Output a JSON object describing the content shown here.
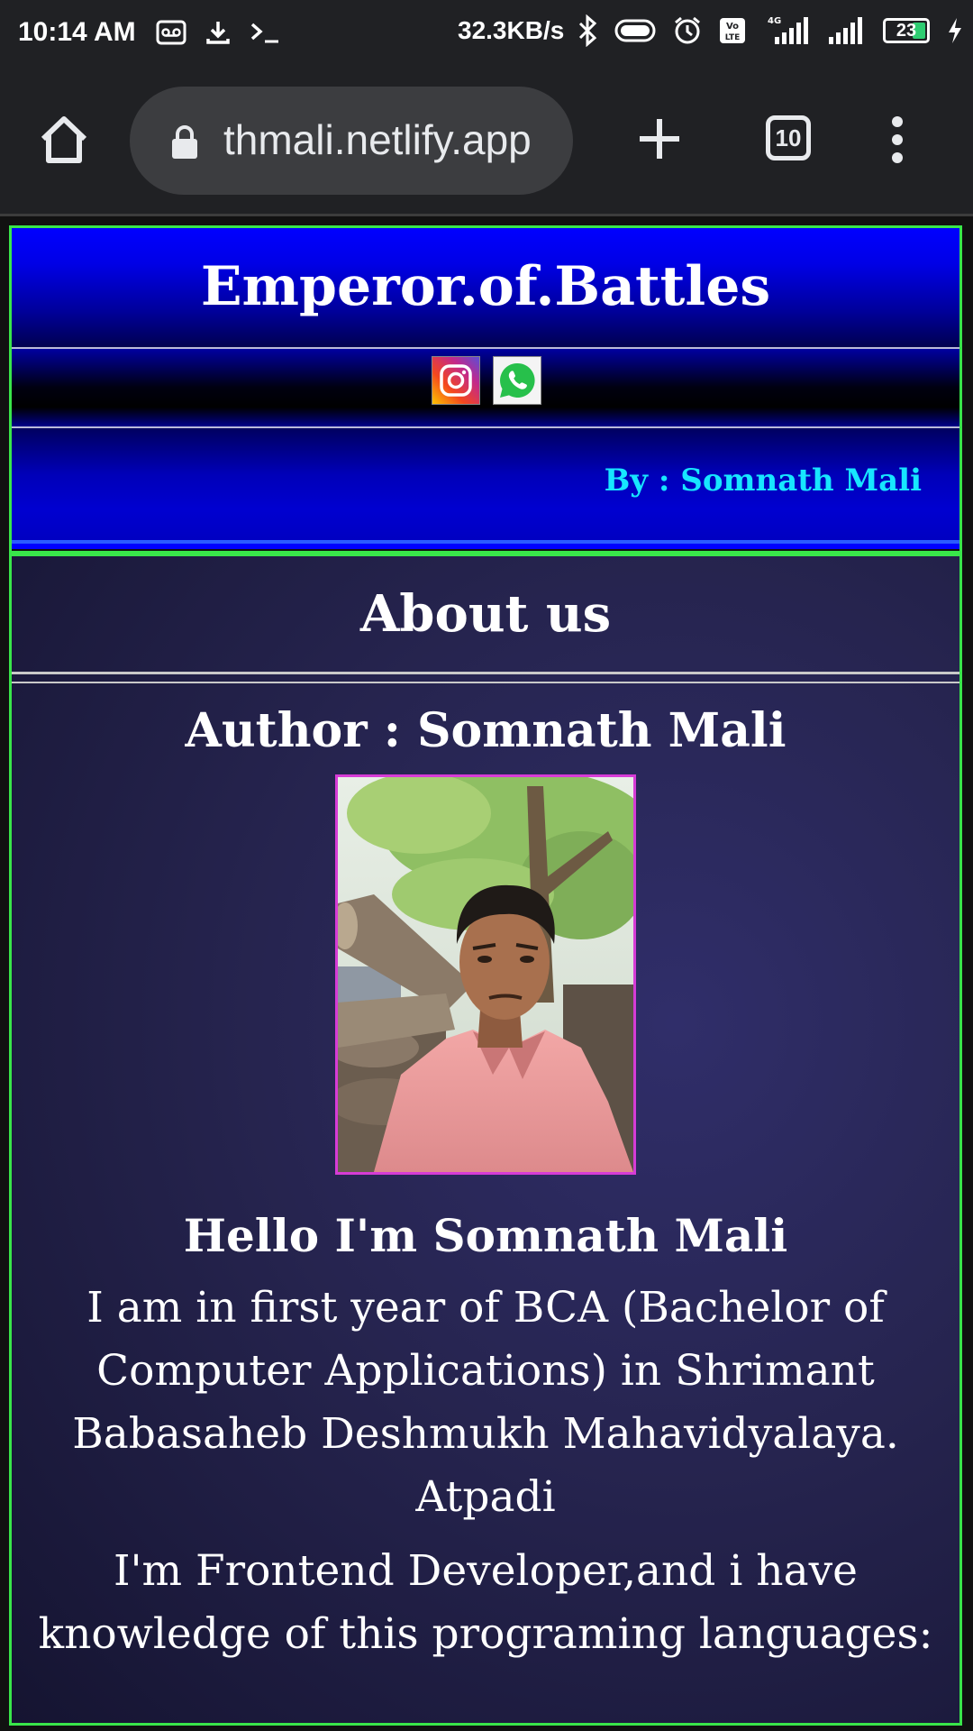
{
  "status_bar": {
    "time": "10:14 AM",
    "speed": "32.3KB/s",
    "battery": "23",
    "icons_left": [
      "voicemail-icon",
      "download-icon",
      "terminal-icon"
    ],
    "icons_right": [
      "bluetooth-icon",
      "toggle-icon",
      "alarm-icon",
      "volte-icon",
      "signal-icon",
      "signal-icon",
      "battery-icon",
      "charging-icon"
    ]
  },
  "browser": {
    "url": "thmali.netlify.app",
    "tab_count": "10"
  },
  "header": {
    "title": "Emperor.of.Battles",
    "by_line": "By : Somnath Mali",
    "social": [
      "instagram-icon",
      "whatsapp-icon"
    ]
  },
  "about": {
    "title": "About us",
    "author_heading": "Author : Somnath Mali",
    "hello": "Hello I'm Somnath Mali",
    "para1": "I am in first year of BCA (Bachelor of Computer Applications) in Shrimant Babasaheb Deshmukh Mahavidyalaya. Atpadi",
    "para2": "I'm Frontend Developer,and i have knowledge of this programing languages:"
  },
  "colors": {
    "accent_border": "#39e64a",
    "header_blue": "#0000ff",
    "by_text": "#17e6ff",
    "photo_border": "#d63cd6"
  }
}
